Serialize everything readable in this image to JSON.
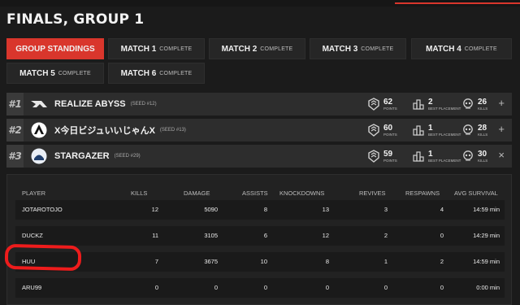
{
  "title": "FINALS, GROUP 1",
  "tabs": [
    {
      "label": "GROUP STANDINGS",
      "status": ""
    },
    {
      "label": "MATCH 1",
      "status": "COMPLETE"
    },
    {
      "label": "MATCH 2",
      "status": "COMPLETE"
    },
    {
      "label": "MATCH 3",
      "status": "COMPLETE"
    },
    {
      "label": "MATCH 4",
      "status": "COMPLETE"
    },
    {
      "label": "MATCH 5",
      "status": "COMPLETE"
    },
    {
      "label": "MATCH 6",
      "status": "COMPLETE"
    }
  ],
  "stat_labels": {
    "points": "POINTS",
    "best_placement": "BEST PLACEMENT",
    "kills": "KILLS"
  },
  "teams": [
    {
      "rank": "#1",
      "name": "REALIZE ABYSS",
      "seed": "(SEED #12)",
      "points": "62",
      "best_placement": "2",
      "kills": "26",
      "toggle": "+"
    },
    {
      "rank": "#2",
      "name": "X今日ビジュいいじゃんX",
      "seed": "(SEED #13)",
      "points": "60",
      "best_placement": "1",
      "kills": "28",
      "toggle": "+"
    },
    {
      "rank": "#3",
      "name": "STARGAZER",
      "seed": "(SEED #29)",
      "points": "59",
      "best_placement": "1",
      "kills": "30",
      "toggle": "×"
    }
  ],
  "player_table": {
    "headers": [
      "PLAYER",
      "KILLS",
      "DAMAGE",
      "ASSISTS",
      "KNOCKDOWNS",
      "REVIVES",
      "RESPAWNS",
      "AVG SURVIVAL"
    ],
    "rows": [
      [
        "JOTAROTOJO",
        "12",
        "5090",
        "8",
        "13",
        "3",
        "4",
        "14:59 min"
      ],
      [
        "DUCKZ",
        "11",
        "3105",
        "6",
        "12",
        "2",
        "0",
        "14:29 min"
      ],
      [
        "HUU",
        "7",
        "3675",
        "10",
        "8",
        "1",
        "2",
        "14:59 min"
      ],
      [
        "ARU99",
        "0",
        "0",
        "0",
        "0",
        "0",
        "0",
        "0:00 min"
      ]
    ]
  },
  "colors": {
    "accent": "#d9362c",
    "annotation": "#ee1c1c"
  }
}
